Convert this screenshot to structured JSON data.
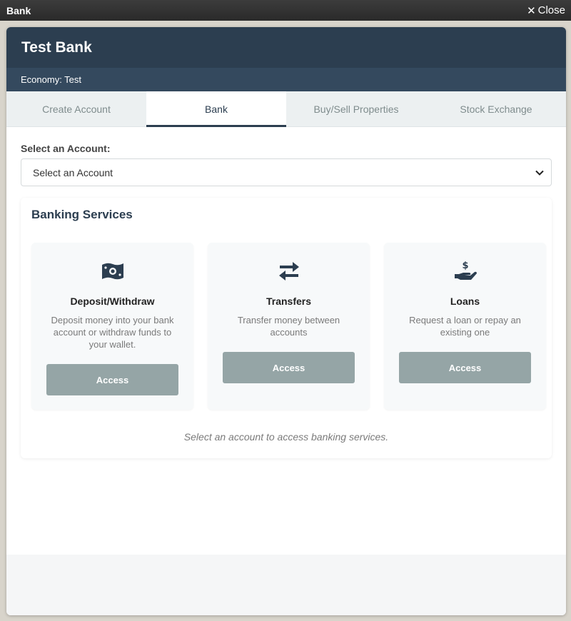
{
  "titlebar": {
    "title": "Bank",
    "close_label": "Close",
    "close_icon": "close-icon"
  },
  "header": {
    "bank_name": "Test Bank",
    "economy": "Economy: Test"
  },
  "tabs": [
    {
      "label": "Create Account",
      "active": false
    },
    {
      "label": "Bank",
      "active": true
    },
    {
      "label": "Buy/Sell Properties",
      "active": false
    },
    {
      "label": "Stock Exchange",
      "active": false
    }
  ],
  "account_select": {
    "label": "Select an Account:",
    "value": "Select an Account"
  },
  "services": {
    "title": "Banking Services",
    "items": [
      {
        "icon": "money-bill-icon",
        "title": "Deposit/Withdraw",
        "description": "Deposit money into your bank account or withdraw funds to your wallet.",
        "button": "Access"
      },
      {
        "icon": "exchange-arrows-icon",
        "title": "Transfers",
        "description": "Transfer money between accounts",
        "button": "Access"
      },
      {
        "icon": "hand-dollar-icon",
        "title": "Loans",
        "description": "Request a loan or repay an existing one",
        "button": "Access"
      }
    ],
    "note": "Select an account to access banking services."
  },
  "colors": {
    "header": "#2c3e50",
    "subheader": "#34495e",
    "button": "#95a5a6"
  }
}
